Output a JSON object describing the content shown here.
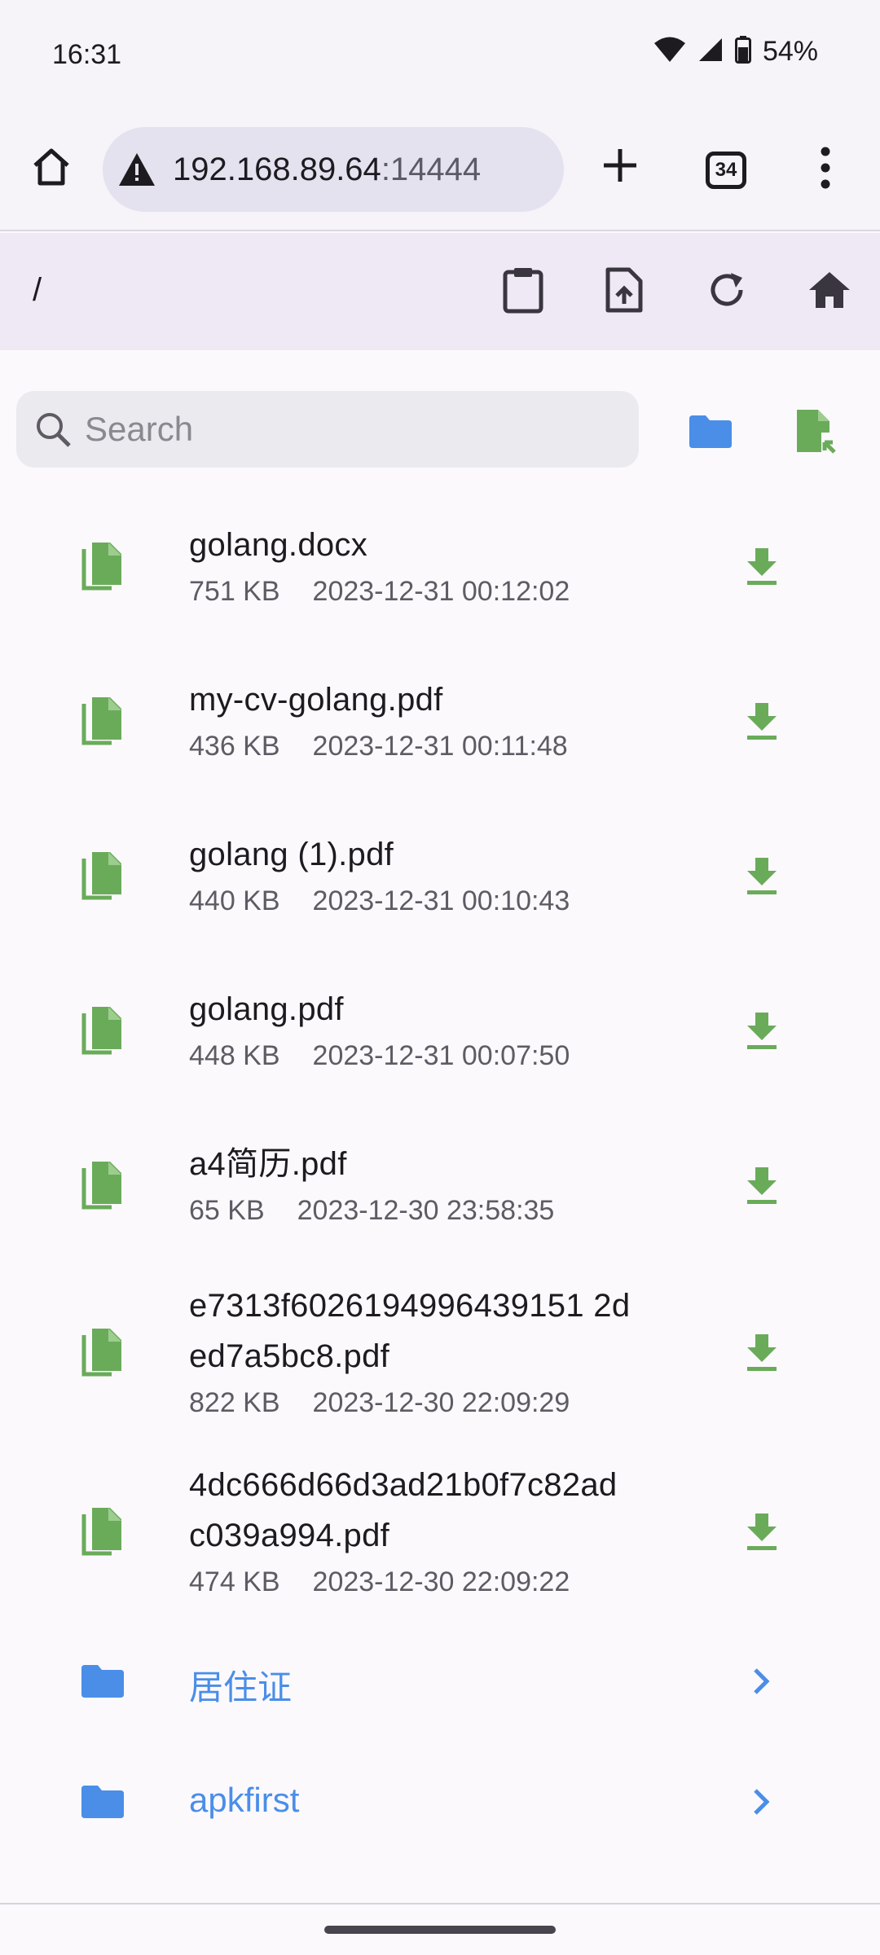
{
  "status": {
    "time": "16:31",
    "battery": "54%"
  },
  "browser": {
    "url_host": "192.168.89.64",
    "url_port": ":14444",
    "tab_count": "34"
  },
  "header": {
    "path": "/"
  },
  "search": {
    "placeholder": "Search",
    "value": ""
  },
  "files": [
    {
      "name_lines": [
        "golang.docx"
      ],
      "size": "751 KB",
      "date": "2023-12-31 00:12:02"
    },
    {
      "name_lines": [
        "my-cv-golang.pdf"
      ],
      "size": "436 KB",
      "date": "2023-12-31 00:11:48"
    },
    {
      "name_lines": [
        "golang (1).pdf"
      ],
      "size": "440 KB",
      "date": "2023-12-31 00:10:43"
    },
    {
      "name_lines": [
        "golang.pdf"
      ],
      "size": "448 KB",
      "date": "2023-12-31 00:07:50"
    },
    {
      "name_lines": [
        "a4简历.pdf"
      ],
      "size": "65 KB",
      "date": "2023-12-30 23:58:35"
    },
    {
      "name_lines": [
        "e7313f6026194996439151 2d",
        "ed7a5bc8.pdf"
      ],
      "size": "822 KB",
      "date": "2023-12-30 22:09:29"
    },
    {
      "name_lines": [
        "4dc666d66d3ad21b0f7c82ad",
        "c039a994.pdf"
      ],
      "size": "474 KB",
      "date": "2023-12-30 22:09:22"
    }
  ],
  "folders": [
    {
      "name": "居住证"
    },
    {
      "name": "apkfirst"
    }
  ],
  "colors": {
    "file_green": "#6aab5a",
    "folder_blue": "#4a8ee8",
    "icon_dark": "#3a3640"
  }
}
